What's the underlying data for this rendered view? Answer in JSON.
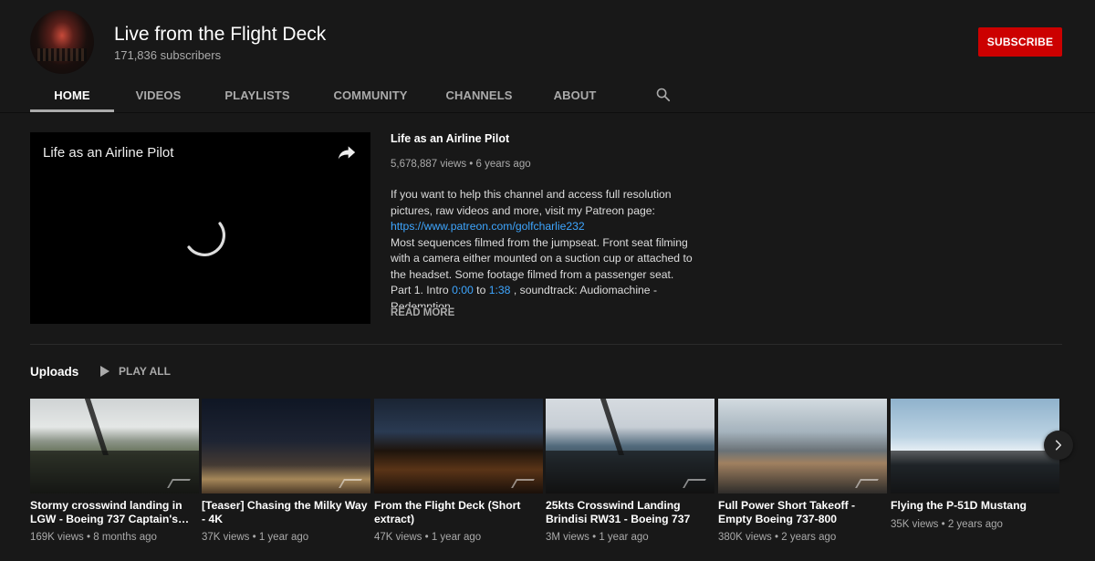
{
  "channel": {
    "title": "Live from the Flight Deck",
    "subscribers": "171,836 subscribers",
    "subscribe_label": "SUBSCRIBE"
  },
  "tabs": [
    {
      "label": "HOME",
      "active": true
    },
    {
      "label": "VIDEOS"
    },
    {
      "label": "PLAYLISTS"
    },
    {
      "label": "COMMUNITY"
    },
    {
      "label": "CHANNELS"
    },
    {
      "label": "ABOUT"
    }
  ],
  "featured": {
    "player_title": "Life as an Airline Pilot",
    "title": "Life as an Airline Pilot",
    "meta": "5,678,887 views • 6 years ago",
    "desc_line1": "If you want to help this channel and access full resolution pictures, raw videos and more, visit my Patreon page:",
    "desc_link": "https://www.patreon.com/golfcharlie232",
    "desc_line2": "Most sequences filmed from the jumpseat. Front seat filming with a camera either mounted on a suction cup or attached to the headset. Some footage filmed from a passenger seat.",
    "desc_part_prefix": "Part 1. Intro ",
    "desc_time1": "0:00",
    "desc_to": " to ",
    "desc_time2": "1:38",
    "desc_part_suffix": " , soundtrack: Audiomachine - Redemption",
    "read_more": "READ MORE"
  },
  "uploads": {
    "label": "Uploads",
    "play_all": "PLAY ALL",
    "videos": [
      {
        "title": "Stormy crosswind landing in LGW - Boeing 737 Captain's…",
        "meta": "169K views • 8 months ago"
      },
      {
        "title": "[Teaser] Chasing the Milky Way - 4K",
        "meta": "37K views • 1 year ago"
      },
      {
        "title": "From the Flight Deck (Short extract)",
        "meta": "47K views • 1 year ago"
      },
      {
        "title": "25kts Crosswind Landing Brindisi RW31 - Boeing 737",
        "meta": "3M views • 1 year ago"
      },
      {
        "title": "Full Power Short Takeoff - Empty Boeing 737-800",
        "meta": "380K views • 2 years ago"
      },
      {
        "title": "Flying the P-51D Mustang",
        "meta": "35K views • 2 years ago"
      }
    ]
  },
  "colors": {
    "background": "#181818",
    "subscribe": "#cc0000",
    "link": "#3ea6ff",
    "muted_text": "#aaaaaa"
  },
  "icons": [
    "search-icon",
    "share-icon",
    "loading-spinner-icon",
    "play-icon",
    "chevron-right-icon"
  ]
}
